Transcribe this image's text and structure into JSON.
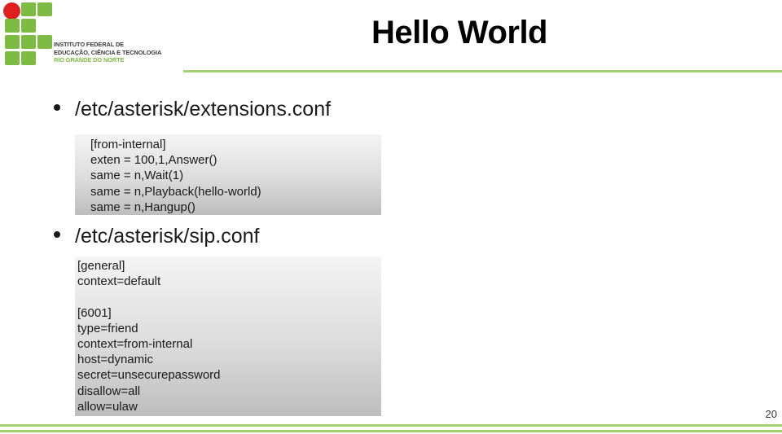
{
  "logo": {
    "line1": "INSTITUTO FEDERAL DE",
    "line2": "EDUCAÇÃO, CIÊNCIA E TECNOLOGIA",
    "line3": "RIO GRANDE DO NORTE",
    "colors": {
      "green": "#7dbb43",
      "red": "#e0201f"
    }
  },
  "slide": {
    "title": "Hello World",
    "page_number": "20",
    "accent_rule_color": "#9fd26f"
  },
  "bullets": [
    {
      "label": "/etc/asterisk/extensions.conf",
      "code": [
        "[from-internal]",
        "exten = 100,1,Answer()",
        "same = n,Wait(1)",
        "same = n,Playback(hello-world)",
        "same = n,Hangup()"
      ]
    },
    {
      "label": "/etc/asterisk/sip.conf",
      "code": [
        "[general]",
        "context=default",
        "",
        "[6001]",
        "type=friend",
        "context=from-internal",
        "host=dynamic",
        "secret=unsecurepassword",
        "disallow=all",
        "allow=ulaw"
      ]
    }
  ]
}
